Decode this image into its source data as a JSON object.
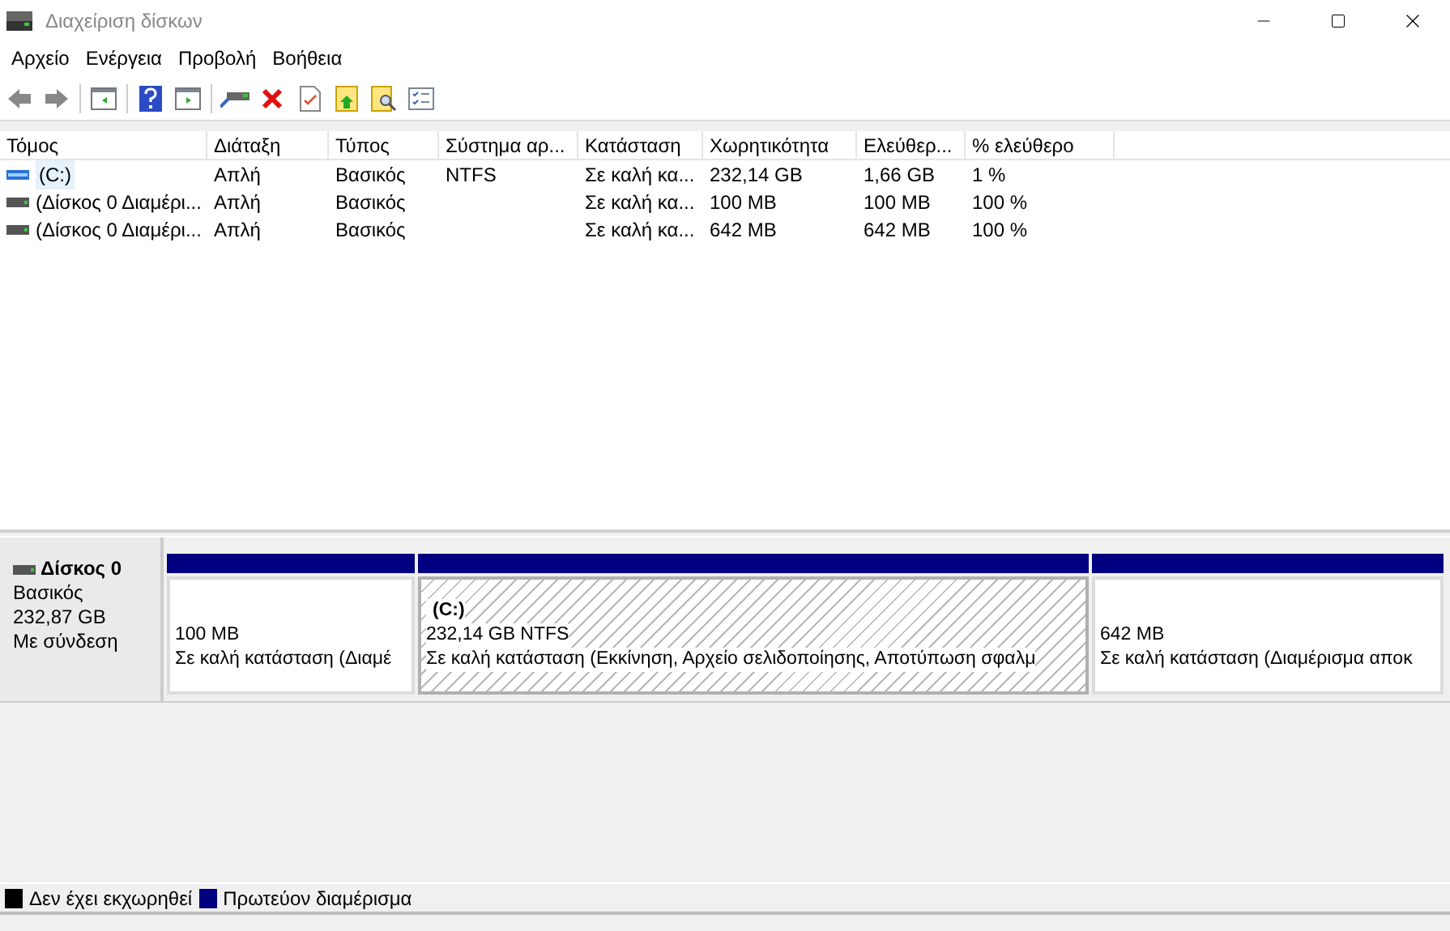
{
  "window": {
    "title": "Διαχείριση δίσκων"
  },
  "menu": [
    "Αρχείο",
    "Ενέργεια",
    "Προβολή",
    "Βοήθεια"
  ],
  "table": {
    "columns": [
      "Τόμος",
      "Διάταξη",
      "Τύπος",
      "Σύστημα αρ...",
      "Κατάσταση",
      "Χωρητικότητα",
      "Ελεύθερ...",
      "% ελεύθερο"
    ],
    "rows": [
      {
        "kind": "volume",
        "selected": true,
        "cells": [
          "(C:)",
          "Απλή",
          "Βασικός",
          "NTFS",
          "Σε καλή κα...",
          "232,14 GB",
          "1,66 GB",
          "1 %"
        ]
      },
      {
        "kind": "drive",
        "selected": false,
        "cells": [
          "(Δίσκος 0 Διαμέρι...",
          "Απλή",
          "Βασικός",
          "",
          "Σε καλή κα...",
          "100 MB",
          "100 MB",
          "100 %"
        ]
      },
      {
        "kind": "drive",
        "selected": false,
        "cells": [
          "(Δίσκος 0 Διαμέρι...",
          "Απλή",
          "Βασικός",
          "",
          "Σε καλή κα...",
          "642 MB",
          "642 MB",
          "100 %"
        ]
      }
    ]
  },
  "disk": {
    "name": "Δίσκος 0",
    "type": "Βασικός",
    "size": "232,87 GB",
    "status": "Με σύνδεση",
    "partitions": [
      {
        "selected": false,
        "color": "#000080",
        "size": "100 MB",
        "status": "Σε καλή κατάσταση (Διαμέ"
      },
      {
        "selected": true,
        "color": "#000080",
        "label": "(C:)",
        "size": "232,14 GB NTFS",
        "status": "Σε καλή κατάσταση (Εκκίνηση, Αρχείο σελιδοποίησης, Αποτύπωση σφαλμ"
      },
      {
        "selected": false,
        "color": "#000080",
        "size": "642 MB",
        "status": "Σε καλή κατάσταση (Διαμέρισμα αποκ"
      }
    ]
  },
  "legend": [
    {
      "label": "Δεν έχει εκχωρηθεί",
      "color": "#000000"
    },
    {
      "label": "Πρωτεύον διαμέρισμα",
      "color": "#000080"
    }
  ]
}
